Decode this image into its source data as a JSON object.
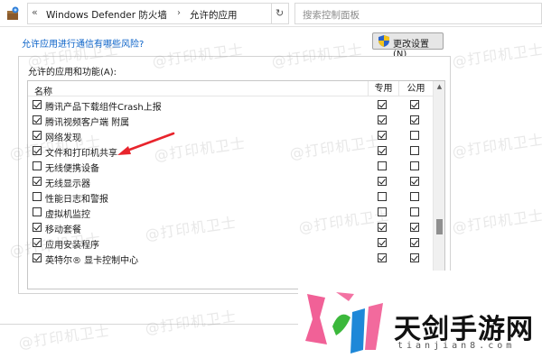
{
  "address_bar": {
    "chevron": "«",
    "crumbs": [
      "Windows Defender 防火墙",
      "允许的应用"
    ],
    "separator": "›",
    "dropdown": "▾",
    "refresh": "↻",
    "search_placeholder": "搜索控制面板"
  },
  "main": {
    "help_link": "允许应用进行通信有哪些风险?",
    "change_settings_button": "更改设置(N)",
    "panel_title": "允许的应用和功能(A):",
    "columns": {
      "name": "名称",
      "private": "专用",
      "public": "公用"
    },
    "rows": [
      {
        "label": "腾讯产品下载组件Crash上报",
        "enabled": true,
        "private": true,
        "public": true
      },
      {
        "label": "腾讯视频客户端 附属",
        "enabled": true,
        "private": true,
        "public": true
      },
      {
        "label": "网络发现",
        "enabled": true,
        "private": true,
        "public": false
      },
      {
        "label": "文件和打印机共享",
        "enabled": true,
        "private": true,
        "public": false
      },
      {
        "label": "无线便携设备",
        "enabled": false,
        "private": false,
        "public": false
      },
      {
        "label": "无线显示器",
        "enabled": true,
        "private": true,
        "public": true
      },
      {
        "label": "性能日志和警报",
        "enabled": false,
        "private": false,
        "public": false
      },
      {
        "label": "虚拟机监控",
        "enabled": false,
        "private": false,
        "public": false
      },
      {
        "label": "移动套餐",
        "enabled": true,
        "private": true,
        "public": true
      },
      {
        "label": "应用安装程序",
        "enabled": true,
        "private": true,
        "public": true
      },
      {
        "label": "英特尔® 显卡控制中心",
        "enabled": true,
        "private": true,
        "public": true
      }
    ]
  },
  "watermark": "@打印机卫士",
  "brand": {
    "name": "天剑手游网",
    "sub": "tianjian8.com"
  },
  "colors": {
    "link": "#0a62c8",
    "arrow": "#e8242c",
    "brand_pink": "#f0508c",
    "brand_green": "#3cb83c",
    "brand_blue": "#1e88d8"
  }
}
